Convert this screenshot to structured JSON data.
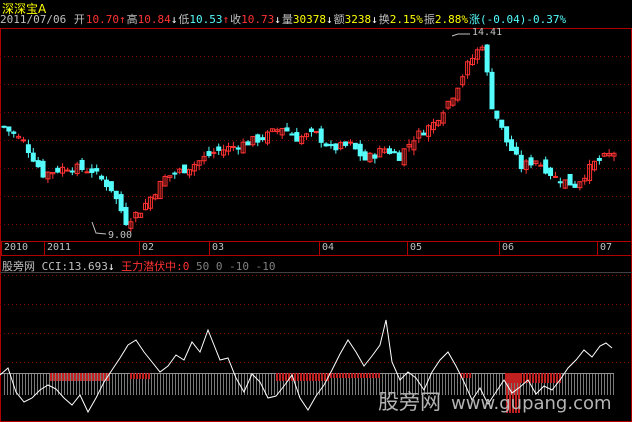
{
  "header": {
    "title": "深深宝A",
    "date": "2011/07/06",
    "open_label": "开",
    "open_value": "10.70",
    "high_label": "高",
    "high_value": "10.84",
    "low_label": "低",
    "low_value": "10.53",
    "close_label": "收",
    "close_value": "10.73",
    "volume_label": "量",
    "volume_value": "30378",
    "amount_label": "额",
    "amount_value": "3238",
    "turnover_label": "换",
    "turnover_value": "2.15%",
    "amplitude_label": "振",
    "amplitude_value": "2.88%",
    "change_label": "涨",
    "change_value": "(-0.04)-0.37%",
    "arrow_up": "↑",
    "arrow_down": "↓"
  },
  "annotations": {
    "high_price": "14.41",
    "low_price": "9.00"
  },
  "x_axis": {
    "labels": [
      "2010",
      "2011",
      "02",
      "03",
      "04",
      "05",
      "06",
      "07"
    ]
  },
  "indicator": {
    "source": "股旁网",
    "cci_label": "CCI:13.693",
    "arrow": "↓",
    "series_label": "王力潜伏中:0",
    "levels": "50 0 -10 -10"
  },
  "watermark": {
    "text": "股旁网",
    "url": "www.gupang.com"
  },
  "colors": {
    "up": "#ff3232",
    "down": "#54fcfc",
    "grid": "#800000",
    "axis": "#b00000",
    "text": "#c0c0c0",
    "yellow": "#ffff00",
    "cci_line": "#ffffff"
  },
  "chart_data": {
    "type": "candlestick",
    "price_labels": {
      "max": 14.41,
      "min": 9.0
    },
    "x_labels": [
      "2010",
      "2011",
      "02",
      "03",
      "04",
      "05",
      "06",
      "07"
    ],
    "indicator_line": {
      "name": "CCI",
      "last_value": 13.693
    }
  }
}
